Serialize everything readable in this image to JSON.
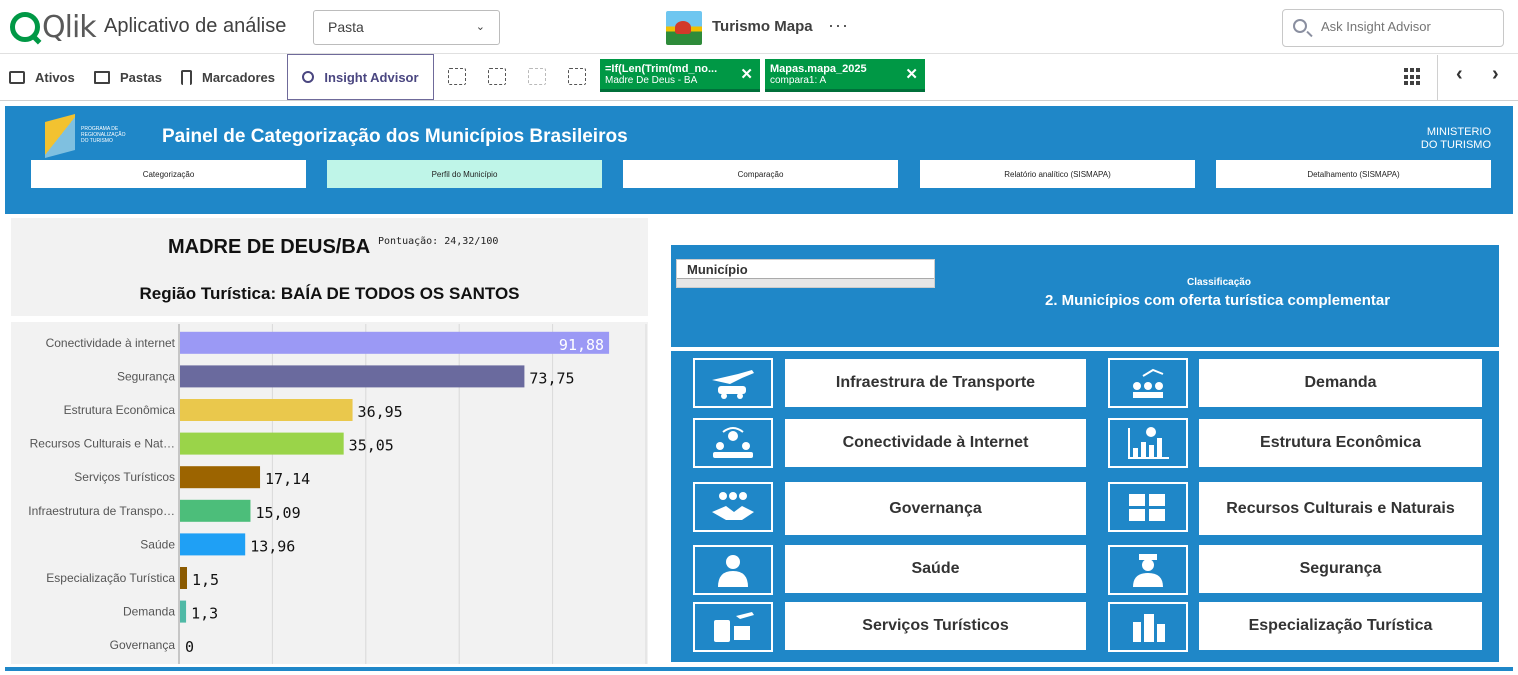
{
  "header": {
    "logo": "Qlik",
    "app_title": "Aplicativo de análise",
    "sheet_dropdown": "Pasta",
    "app_name": "Turismo Mapa",
    "more": "···",
    "search_placeholder": "Ask Insight Advisor"
  },
  "toolbar": {
    "ativos": "Ativos",
    "pastas": "Pastas",
    "marcadores": "Marcadores",
    "insight": "Insight Advisor",
    "selections": [
      {
        "title": "=If(Len(Trim(md_no...",
        "value": "Madre De Deus - BA"
      },
      {
        "title": "Mapas.mapa_2025",
        "value": "compara1: A"
      }
    ]
  },
  "banner": {
    "logo_text": "PROGRAMA DE REGIONALIZAÇÃO DO TURISMO",
    "title": "Painel de Categorização dos Municípios Brasileiros",
    "ministerio_line1": "MINISTERIO",
    "ministerio_line2": "DO TURISMO",
    "tabs": [
      "Categorização",
      "Perfil do Município",
      "Comparação",
      "Relatório analítico (SISMAPA)",
      "Detalhamento (SISMAPA)"
    ],
    "active_tab": 1
  },
  "municipio": {
    "name": "MADRE DE DEUS/BA",
    "score": "Pontuação: 24,32/100",
    "regiao": "Região Turística: BAÍA DE TODOS OS SANTOS"
  },
  "chart_data": {
    "type": "bar",
    "orientation": "horizontal",
    "categories": [
      "Conectividade à internet",
      "Segurança",
      "Estrutura Econômica",
      "Recursos Culturais e Nat…",
      "Serviços Turísticos",
      "Infraestrutura de Transpo…",
      "Saúde",
      "Especialização Turística",
      "Demanda",
      "Governança"
    ],
    "values": [
      91.88,
      73.75,
      36.95,
      35.05,
      17.14,
      15.09,
      13.96,
      1.5,
      1.3,
      0
    ],
    "labels": [
      "91,88",
      "73,75",
      "36,95",
      "35,05",
      "17,14",
      "15,09",
      "13,96",
      "1,5",
      "1,3",
      "0"
    ],
    "colors": [
      "#9b99f5",
      "#6a6a9e",
      "#eac84c",
      "#9ad449",
      "#9c6400",
      "#4cbe7a",
      "#1fa0f5",
      "#8b5a00",
      "#4fb9a6",
      "#888888"
    ],
    "xlim": [
      0,
      100
    ],
    "grid": true
  },
  "classificacao": {
    "table_header": "Município",
    "label": "Classificação",
    "value": "2. Municípios com oferta turística complementar"
  },
  "dimensoes": [
    {
      "left": "Infraestrura de Transporte",
      "right": "Demanda"
    },
    {
      "left": "Conectividade à Internet",
      "right": "Estrutura Econômica"
    },
    {
      "left": "Governança",
      "right": "Recursos Culturais e Naturais"
    },
    {
      "left": "Saúde",
      "right": "Segurança"
    },
    {
      "left": "Serviços Turísticos",
      "right": "Especialização Turística"
    }
  ]
}
